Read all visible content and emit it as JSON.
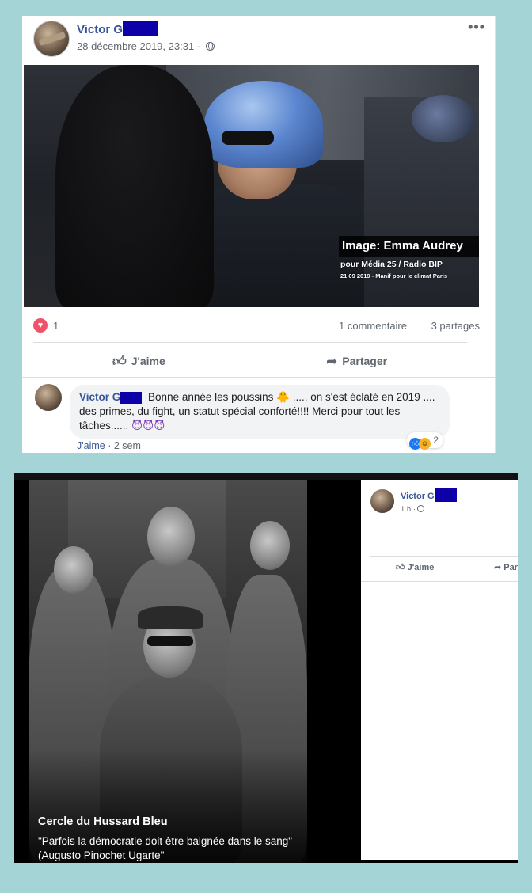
{
  "post1": {
    "author": "Victor G",
    "date": "28 décembre 2019, 23:31 ·",
    "more_icon": "more-dots-icon",
    "photo": {
      "label": "Image: Emma Audrey",
      "caption1": "pour Média 25 / Radio BIP",
      "caption2": "21 09 2019 - Manif pour le climat Paris"
    },
    "reactions": {
      "count": "1",
      "comments": "1 commentaire",
      "shares": "3 partages"
    },
    "actions": {
      "like": "J'aime",
      "share": "Partager"
    },
    "comment": {
      "author": "Victor G",
      "text_a": "Bonne année les poussins",
      "emoji_chick": "🐥",
      "text_b": "..... on s'est éclaté en 2019 .... des primes, du fight, un statut spécial conforté!!!! Merci pour tout les tâches......",
      "emoji_devils": "😈😈😈",
      "reaction_count": "2",
      "meta_like": "J'aime",
      "meta_time": "· 2 sem"
    }
  },
  "post2": {
    "photo_title": "Cercle du Hussard Bleu",
    "photo_quote": "\"Parfois la démocratie doit être baignée dans le sang\" (Augusto Pinochet Ugarte\"",
    "author": "Victor G",
    "time": "1 h ·",
    "actions": {
      "like": "J'aime",
      "share": "Partager"
    }
  },
  "colors": {
    "background": "#a4d4d6",
    "link": "#365899",
    "redaction": "#0d00a8",
    "love": "#f25268"
  }
}
